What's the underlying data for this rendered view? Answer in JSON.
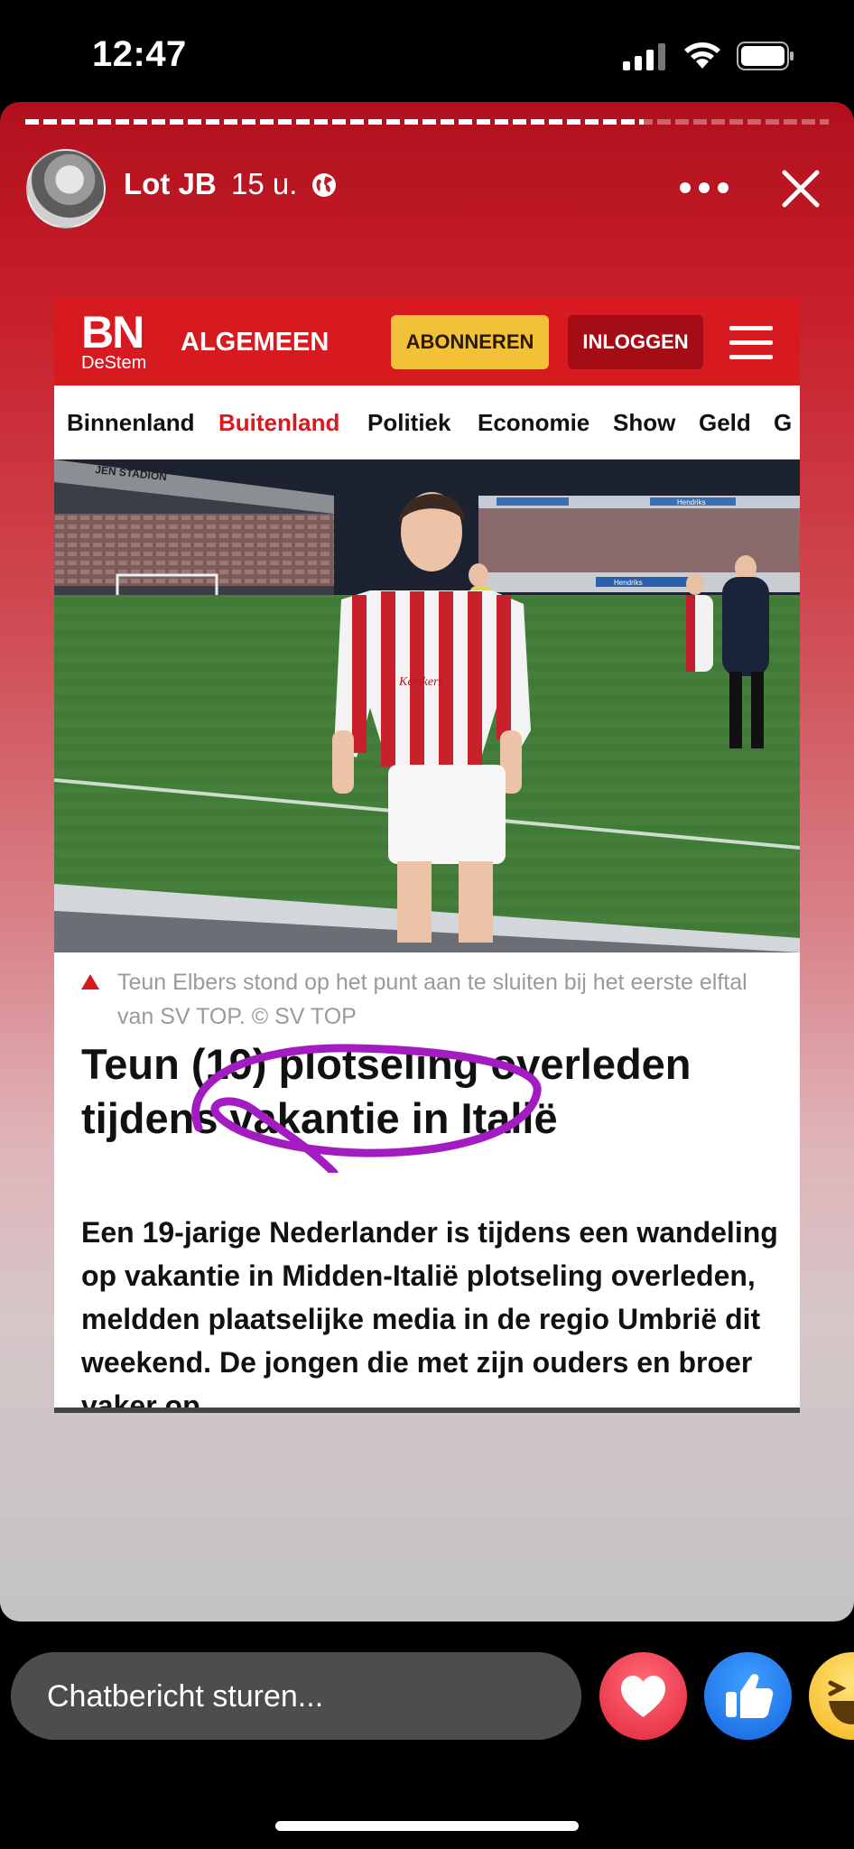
{
  "status_bar": {
    "time": "12:47"
  },
  "story": {
    "progress_fraction": 0.77,
    "author": {
      "name": "Lot JB",
      "time": "15 u."
    }
  },
  "article": {
    "logo": {
      "brand": "BN",
      "sub": "DeStem"
    },
    "section": "ALGEMEEN",
    "subscribe_label": "ABONNEREN",
    "login_label": "INLOGGEN",
    "nav": [
      {
        "label": "Binnenland",
        "active": false
      },
      {
        "label": "Buitenland",
        "active": true
      },
      {
        "label": "Politiek",
        "active": false
      },
      {
        "label": "Economie",
        "active": false
      },
      {
        "label": "Show",
        "active": false
      },
      {
        "label": "Geld",
        "active": false
      },
      {
        "label": "G",
        "active": false
      }
    ],
    "photo": {
      "stadium_sign": "JEN STADION",
      "shirt_sponsor": "Kemkers",
      "board_text": "Hendriks"
    },
    "caption": "Teun Elbers stond op het punt aan te sluiten bij het eerste elftal van SV TOP. © SV TOP",
    "headline": "Teun (19) plotseling overleden tijdens vakantie in Italië",
    "lead": "Een 19-jarige Nederlander is tijdens een wandeling op vakantie in Midden-Italië plotseling overleden, meldden plaatselijke media in de regio Umbrië dit weekend. De jongen die met zijn ouders en broer vaker op"
  },
  "bottom": {
    "chat_placeholder": "Chatbericht sturen...",
    "reactions": [
      "heart-icon",
      "like-icon",
      "haha-icon"
    ]
  },
  "colors": {
    "brand_red": "#d71920",
    "subscribe_yellow": "#f2c138",
    "scribble_purple": "#a21cc2"
  }
}
